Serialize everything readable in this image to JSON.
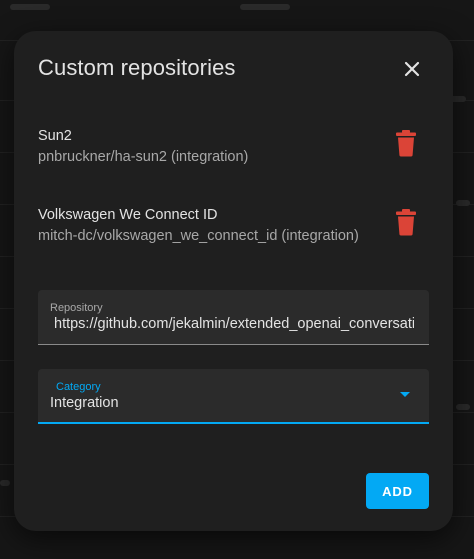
{
  "dialog": {
    "title": "Custom repositories"
  },
  "repositories": [
    {
      "name": "Sun2",
      "path": "pnbruckner/ha-sun2 (integration)"
    },
    {
      "name": "Volkswagen We Connect ID",
      "path": "mitch-dc/volkswagen_we_connect_id (integration)"
    }
  ],
  "form": {
    "repository_label": "Repository",
    "repository_value": "https://github.com/jekalmin/extended_openai_conversation",
    "category_label": "Category",
    "category_value": "Integration"
  },
  "actions": {
    "add_label": "ADD"
  },
  "colors": {
    "accent": "#03a9f4",
    "delete": "#db4437",
    "dialog_bg": "#1f1f1f"
  }
}
